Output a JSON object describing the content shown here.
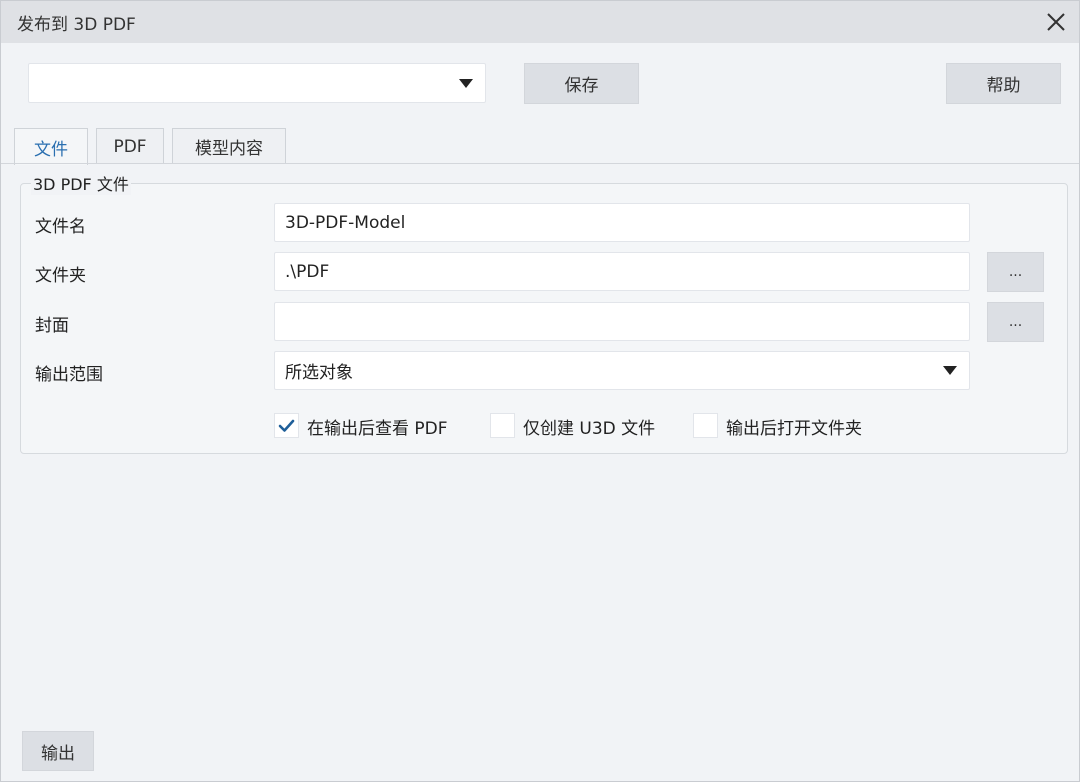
{
  "window": {
    "title": "发布到 3D PDF"
  },
  "toolbar": {
    "preset_value": "",
    "save_label": "保存",
    "help_label": "帮助"
  },
  "tabs": [
    {
      "label": "文件",
      "active": true
    },
    {
      "label": "PDF",
      "active": false
    },
    {
      "label": "模型内容",
      "active": false
    }
  ],
  "group": {
    "title": "3D PDF 文件"
  },
  "form": {
    "filename": {
      "label": "文件名",
      "value": "3D-PDF-Model"
    },
    "folder": {
      "label": "文件夹",
      "value": ".\\PDF",
      "browse_label": "..."
    },
    "cover": {
      "label": "封面",
      "value": "",
      "browse_label": "..."
    },
    "range": {
      "label": "输出范围",
      "value": "所选对象"
    }
  },
  "options": [
    {
      "label": "在输出后查看 PDF",
      "checked": true
    },
    {
      "label": "仅创建 U3D 文件",
      "checked": false
    },
    {
      "label": "输出后打开文件夹",
      "checked": false
    }
  ],
  "footer": {
    "export_label": "输出"
  },
  "colors": {
    "accent": "#2a6fb0",
    "check": "#1f5f99"
  }
}
